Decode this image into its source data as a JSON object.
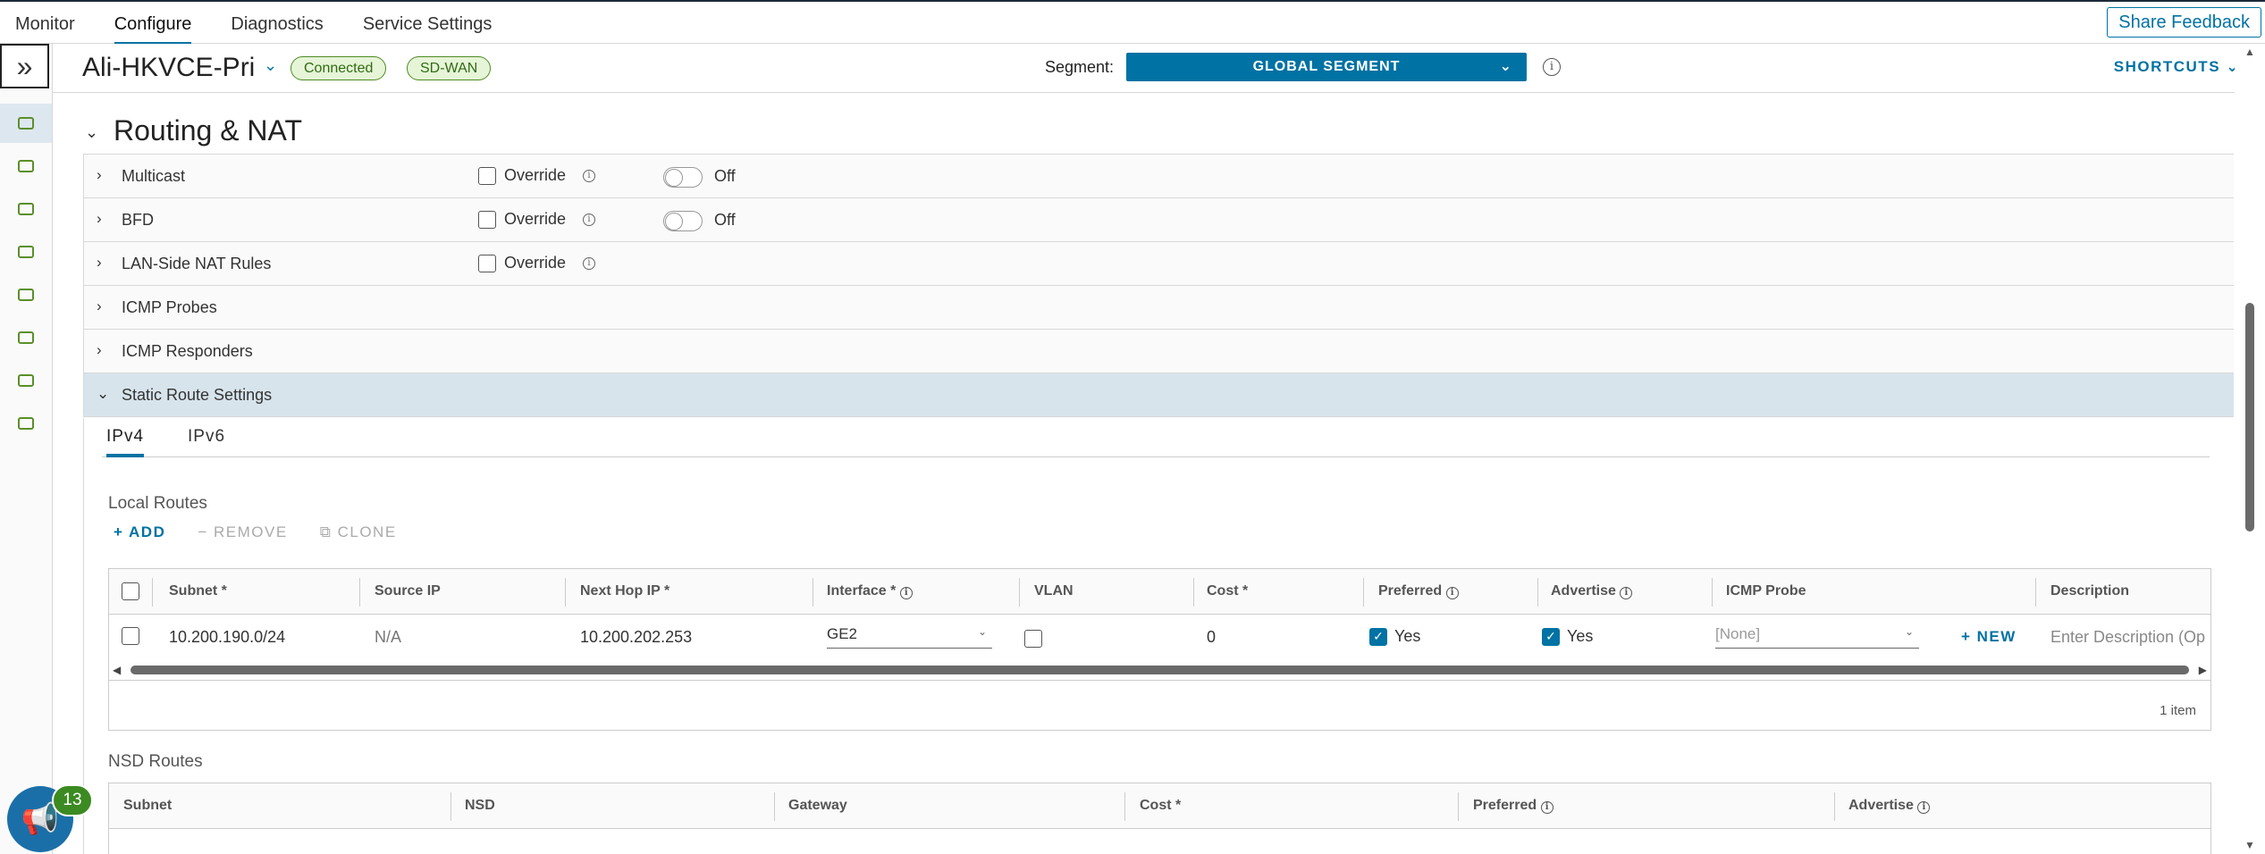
{
  "topnav": {
    "tabs": [
      {
        "label": "Monitor"
      },
      {
        "label": "Configure"
      },
      {
        "label": "Diagnostics"
      },
      {
        "label": "Service Settings"
      }
    ],
    "active_tab": "Configure",
    "share_feedback": "Share Feedback"
  },
  "edge": {
    "name": "Ali-HKVCE-Pri",
    "badges": [
      "Connected",
      "SD-WAN"
    ],
    "segment_label": "Segment:",
    "segment_value": "GLOBAL SEGMENT",
    "shortcuts": "SHORTCUTS"
  },
  "section": {
    "title": "Routing & NAT",
    "rows": [
      {
        "label": "Multicast",
        "override": "Override",
        "toggle": "Off"
      },
      {
        "label": "BFD",
        "override": "Override",
        "toggle": "Off"
      },
      {
        "label": "LAN-Side NAT Rules",
        "override": "Override"
      },
      {
        "label": "ICMP Probes"
      },
      {
        "label": "ICMP Responders"
      },
      {
        "label": "Static Route Settings"
      }
    ]
  },
  "static_routes": {
    "tabs": [
      "IPv4",
      "IPv6"
    ],
    "active_tab": "IPv4",
    "local_routes": {
      "title": "Local Routes",
      "actions": {
        "add": "ADD",
        "remove": "REMOVE",
        "clone": "CLONE"
      },
      "columns": [
        "Subnet *",
        "Source IP",
        "Next Hop IP *",
        "Interface *",
        "VLAN",
        "Cost *",
        "Preferred",
        "Advertise",
        "ICMP Probe",
        "Description"
      ],
      "rows": [
        {
          "subnet": "10.200.190.0/24",
          "source_ip": "N/A",
          "next_hop": "10.200.202.253",
          "interface": "GE2",
          "vlan_checked": false,
          "cost": "0",
          "preferred": "Yes",
          "advertise": "Yes",
          "icmp_probe": "[None]",
          "new_label": "NEW",
          "description_placeholder": "Enter Description (Op"
        }
      ],
      "footer": "1 item"
    },
    "nsd_routes": {
      "title": "NSD Routes",
      "columns": [
        "Subnet",
        "NSD",
        "Gateway",
        "Cost *",
        "Preferred",
        "Advertise"
      ]
    }
  },
  "notifications": {
    "count": "13"
  },
  "colors": {
    "accent": "#0072a3",
    "success_badge": "#e6f5d7",
    "active_row": "#d7e4ec"
  }
}
